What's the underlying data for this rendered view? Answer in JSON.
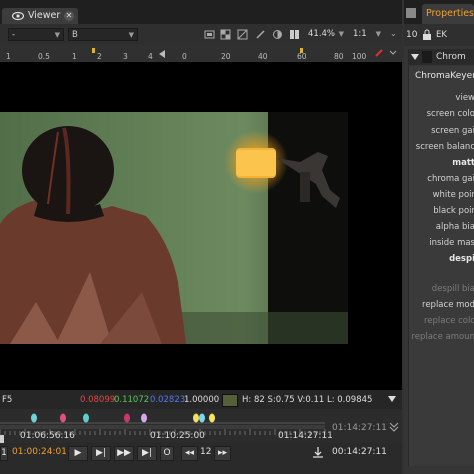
{
  "viewer": {
    "tab_label": "Viewer",
    "toolbar": {
      "channel_value": "-",
      "input_b": "B",
      "zoom": "41.4%",
      "proxy_ratio": "1:1"
    },
    "ruler_ticks": [
      "1",
      "0.5",
      "1",
      "2",
      "3",
      "4"
    ],
    "ruler_right_ticks": [
      "0",
      "20",
      "40",
      "60",
      "80",
      "100"
    ],
    "pixel_info": {
      "frame": "F5",
      "r": "0.08099",
      "g": "0.11072",
      "b": "0.02823",
      "a": "1.00000",
      "hsvl": "H: 82 S:0.75 V:0.11  L: 0.09845",
      "swatch_color": "#55603a"
    },
    "timeline": {
      "timecodes": [
        "01:06:56:16",
        "01:10:25:00",
        "01:14:27:11"
      ],
      "end_timecode": "01:14:27:11",
      "keyframe_colors": [
        "#6cd3d6",
        "#e0507a",
        "#5fd0c8",
        "#c83870",
        "#d5a8e8",
        "#f0e060",
        "#7ad7f0",
        "#f2e45c"
      ]
    },
    "playback": {
      "current_timecode": "01:00:24:01",
      "step": "12",
      "out_timecode": "00:14:27:11"
    }
  },
  "properties": {
    "tab_label": "Properties",
    "count": "10",
    "node_type": "Chrom",
    "node_name": "ChromaKeyer",
    "params": [
      {
        "label": "view",
        "style": "normal"
      },
      {
        "label": "screen colo",
        "style": "normal"
      },
      {
        "label": "screen gai",
        "style": "normal"
      },
      {
        "label": "screen balanc",
        "style": "normal"
      },
      {
        "label": "matt",
        "style": "bold"
      },
      {
        "label": "chroma gai",
        "style": "normal"
      },
      {
        "label": "white poir",
        "style": "normal"
      },
      {
        "label": "black poir",
        "style": "normal"
      },
      {
        "label": "alpha bia",
        "style": "normal"
      },
      {
        "label": "inside mas",
        "style": "normal"
      },
      {
        "label": "despi",
        "style": "bold"
      },
      {
        "label": "despill bia",
        "style": "dim"
      },
      {
        "label": "replace mod",
        "style": "normal"
      },
      {
        "label": "replace colc",
        "style": "dim"
      },
      {
        "label": "replace amoun",
        "style": "dim"
      }
    ]
  }
}
